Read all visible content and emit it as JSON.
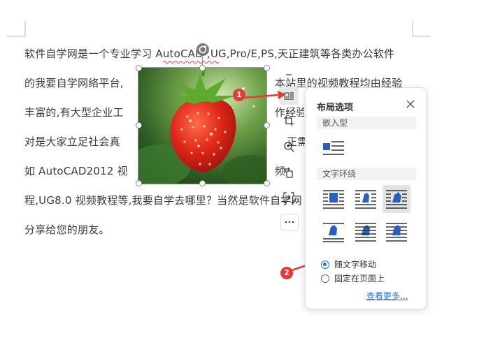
{
  "document": {
    "lines": [
      "软件自学网是一个专业学习 AutoCAD ,UG,Pro/E,PS,天正建筑等各类办公软件",
      "的我要自学网络平台,",
      "丰富的,有大型企业工",
      "对是大家立足社会真",
      "如 AutoCAD2012 视",
      "程,UG8.0 视频教程等,我要自学去哪里？当然是软件自学网",
      "分享给您的朋友。"
    ],
    "right_fragments": [
      "本站里的视频教程均由经验",
      "作经验",
      "正需",
      "频"
    ]
  },
  "layout_panel": {
    "title": "布局选项",
    "section_inline": "嵌入型",
    "section_wrap": "文字环绕",
    "radio_move_with_text": "随文字移动",
    "radio_fixed_on_page": "固定在页面上",
    "see_more": "查看更多...",
    "selected_radio": "随文字移动",
    "selected_wrap_option": 2
  },
  "annotations": {
    "badge1": "1",
    "badge2": "2"
  },
  "colors": {
    "accent": "#2a6fd6",
    "badge": "#e53935",
    "wrap_icon": "#2a5fc0"
  }
}
